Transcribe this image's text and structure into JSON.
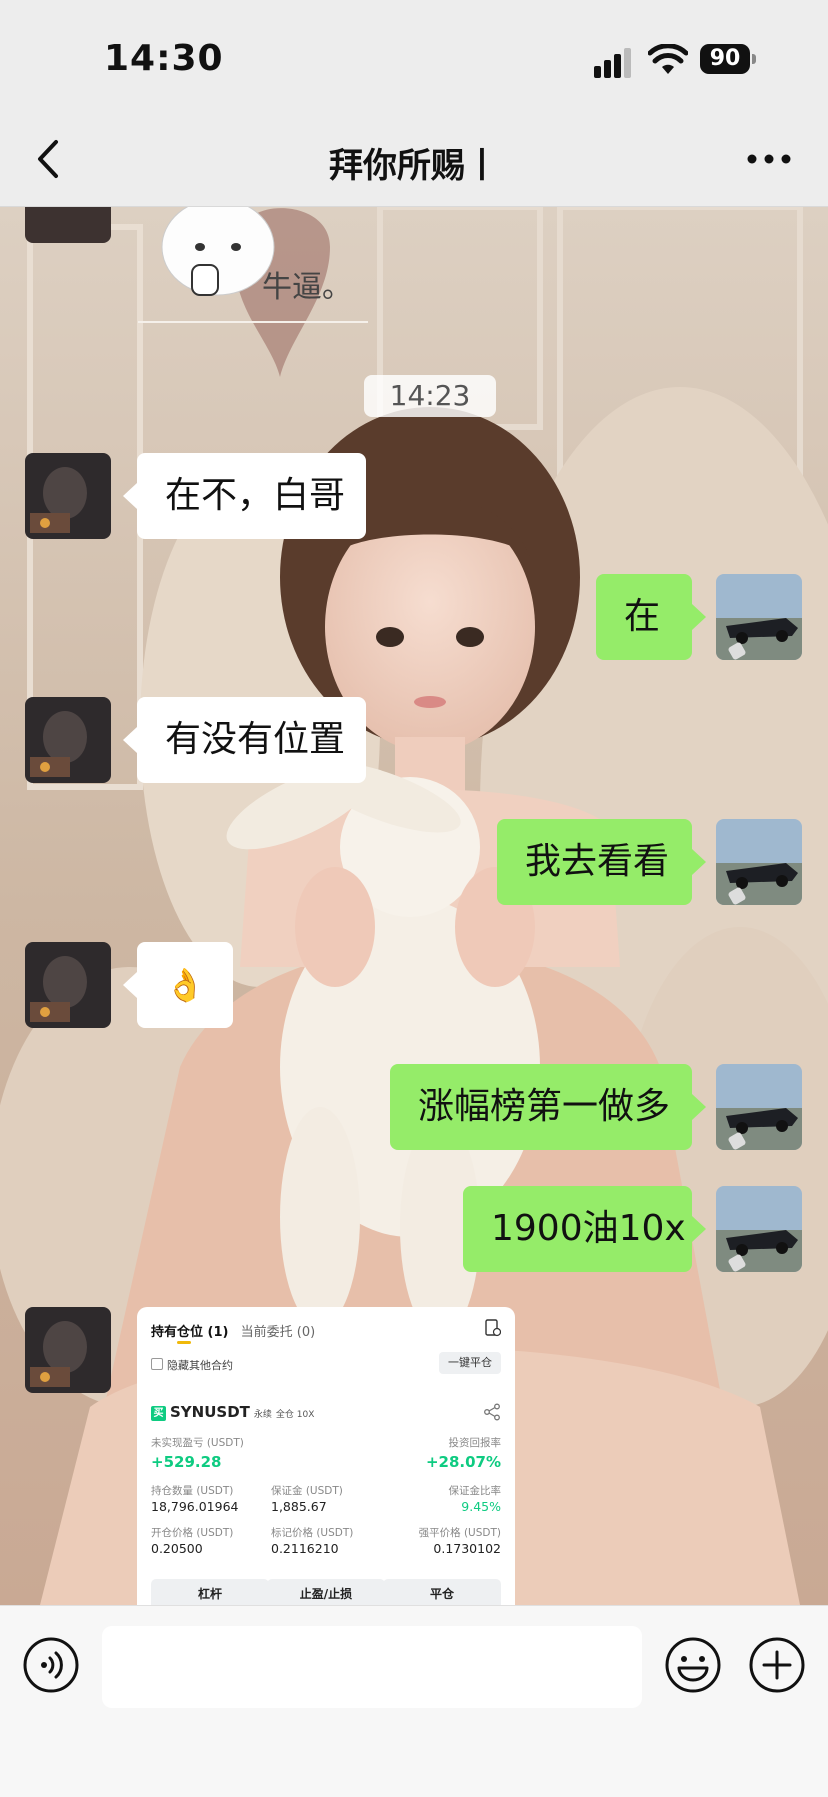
{
  "status_bar": {
    "time": "14:30",
    "battery": "90"
  },
  "header": {
    "title": "拜你所赐丨"
  },
  "chat": {
    "sticker_text": "牛逼。",
    "timestamp": "14:23",
    "messages": [
      {
        "side": "in",
        "text": "在不，白哥"
      },
      {
        "side": "out",
        "text": "在"
      },
      {
        "side": "in",
        "text": "有没有位置"
      },
      {
        "side": "out",
        "text": "我去看看"
      },
      {
        "side": "in",
        "text": "👌"
      },
      {
        "side": "out",
        "text": "涨幅榜第一做多"
      },
      {
        "side": "out",
        "text": "1900油10x"
      }
    ]
  },
  "position_card": {
    "tab_holding": "持有仓位 (1)",
    "tab_orders": "当前委托 (0)",
    "hide_others": "隐藏其他合约",
    "close_all": "一键平仓",
    "side_badge": "买",
    "symbol": "SYNUSDT",
    "tag_perpetual": "永续",
    "tag_margin": "全仓 10X",
    "unrealized_pnl_label": "未实现盈亏 (USDT)",
    "unrealized_pnl": "+529.28",
    "roi_label": "投资回报率",
    "roi": "+28.07%",
    "size_label": "持仓数量 (USDT)",
    "size": "18,796.01964",
    "margin_label": "保证金 (USDT)",
    "margin": "1,885.67",
    "margin_ratio_label": "保证金比率",
    "margin_ratio": "9.45%",
    "entry_price_label": "开仓价格 (USDT)",
    "entry_price": "0.20500",
    "mark_price_label": "标记价格 (USDT)",
    "mark_price": "0.2116210",
    "liq_price_label": "强平价格 (USDT)",
    "liq_price": "0.1730102",
    "btn_leverage": "杠杆",
    "btn_tpsl": "止盈/止损",
    "btn_close": "平仓"
  },
  "input": {
    "value": ""
  },
  "colors": {
    "outgoing_bubble": "#95ec69",
    "incoming_bubble": "#ffffff",
    "profit_green": "#0ecb81"
  }
}
